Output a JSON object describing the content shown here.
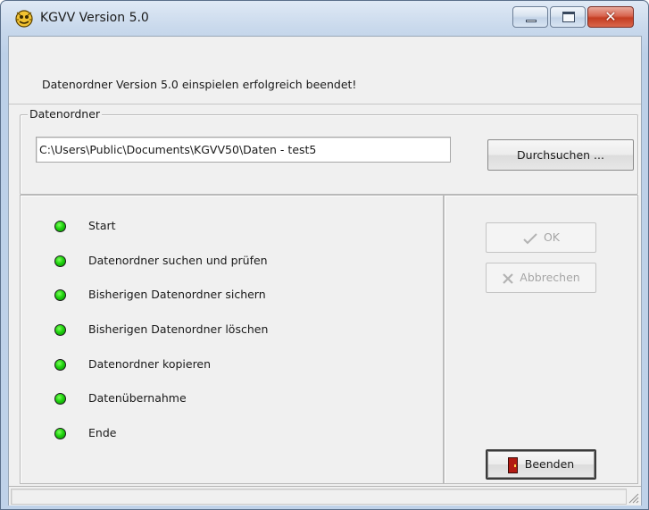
{
  "window": {
    "title": "KGVV Version 5.0",
    "title_color": "#1b1b1b",
    "icon": "kgvv-app-icon",
    "controls": [
      "minimize-icon",
      "maximize-icon",
      "close-icon"
    ],
    "close_glyph": "✕"
  },
  "message": {
    "text": "Datenordner Version 5.0 einspielen erfolgreich beendet!"
  },
  "data_folder": {
    "legend": "Datenordner",
    "path_value": "C:\\Users\\Public\\Documents\\KGVV50\\Daten - test5",
    "browse_label": "Durchsuchen ..."
  },
  "steps": {
    "status_color": "#1fd30f",
    "items": [
      {
        "label": "Start",
        "status": "done"
      },
      {
        "label": "Datenordner suchen und prüfen",
        "status": "done"
      },
      {
        "label": "Bisherigen Datenordner sichern",
        "status": "done"
      },
      {
        "label": "Bisherigen Datenordner löschen",
        "status": "done"
      },
      {
        "label": "Datenordner kopieren",
        "status": "done"
      },
      {
        "label": "Datenübernahme",
        "status": "done"
      },
      {
        "label": "Ende",
        "status": "done"
      }
    ]
  },
  "buttons": {
    "ok_label": "OK",
    "ok_icon": "checkmark-icon",
    "ok_enabled": false,
    "cancel_label": "Abbrechen",
    "cancel_icon": "cross-icon",
    "cancel_enabled": false,
    "exit_label": "Beenden",
    "exit_icon": "exit-door-icon",
    "exit_enabled": true
  },
  "statusbar": {
    "text": ""
  }
}
